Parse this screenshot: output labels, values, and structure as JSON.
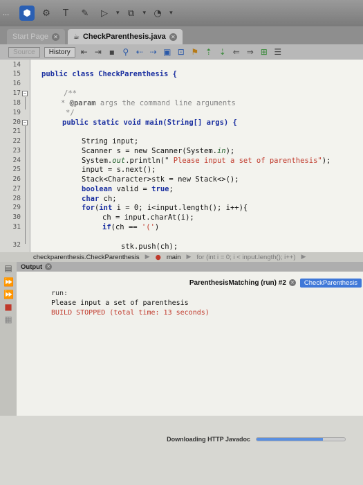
{
  "toolbar": {
    "logo": "...",
    "buttons": [
      "nav-icon",
      "build-hammer-icon",
      "clean-build-icon",
      "run-icon",
      "debug-icon",
      "profile-icon"
    ]
  },
  "tabs": [
    {
      "label": "Start Page",
      "active": false
    },
    {
      "label": "CheckParenthesis.java",
      "active": true
    }
  ],
  "editor_toolbar": {
    "source_label": "Source",
    "history_label": "History"
  },
  "editor": {
    "line_numbers": [
      "14",
      "15",
      "16",
      "17",
      "18",
      "19",
      "20",
      "21",
      "22",
      "23",
      "24",
      "25",
      "26",
      "27",
      "28",
      "29",
      "30",
      "31",
      "32"
    ],
    "lines": {
      "l15": "public class CheckParenthesis {",
      "l17": "/**",
      "l18_tag": "@param",
      "l18_text": " args the command line arguments",
      "l19": "*/",
      "l20": "public static void main(String[] args) {",
      "l22": "String input;",
      "l23a": "Scanner s = new Scanner(System.",
      "l23b": "in",
      "l23c": ");",
      "l24a": "System.",
      "l24b": "out",
      "l24c": ".println(\"",
      "l24d": " Please input a set of parenthesis\"",
      "l24e": ");",
      "l25": "input = s.next();",
      "l26": "Stack<Character>stk = new Stack<>();",
      "l27a": "boolean",
      "l27b": " valid = ",
      "l27c": "true",
      "l27d": ";",
      "l28a": "char",
      "l28b": " ch;",
      "l29a": "for",
      "l29b": "(",
      "l29c": "int",
      "l29d": " i = 0; i<input.length(); i++){",
      "l30": "ch = input.charAt(i);",
      "l31a": "if",
      "l31b": "(ch == ",
      "l31c": "'('",
      "l31d": ")",
      "l32": "stk.push(ch);"
    }
  },
  "breadcrumb": {
    "class": "checkparenthesis.CheckParenthesis",
    "method": "main",
    "loop": "for (int i = 0; i < input.length(); i++)"
  },
  "output": {
    "header": "Output",
    "run_tab": "ParenthesisMatching (run) #2",
    "run_tab2": "CheckParenthesis",
    "lines": [
      {
        "text": "run:",
        "color": "#333333"
      },
      {
        "text": "Please input a set of parenthesis",
        "color": "#111111"
      },
      {
        "text": "BUILD STOPPED (total time: 13 seconds)",
        "color": "#c0392b"
      }
    ]
  },
  "status": {
    "text": "Downloading HTTP Javadoc",
    "progress": 0.75
  }
}
